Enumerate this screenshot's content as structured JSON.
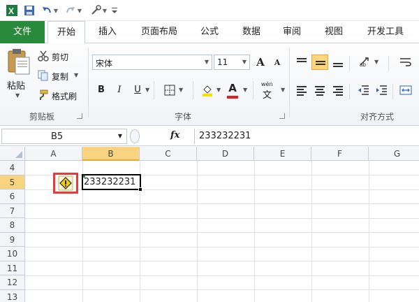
{
  "quick_access": {
    "icons": [
      "excel-icon",
      "save-icon",
      "undo-icon",
      "redo-icon",
      "customize-icon"
    ]
  },
  "tabs": [
    {
      "label": "文件",
      "active": false,
      "accent": "#2a8a3b"
    },
    {
      "label": "开始",
      "active": true
    },
    {
      "label": "插入",
      "active": false
    },
    {
      "label": "页面布局",
      "active": false
    },
    {
      "label": "公式",
      "active": false
    },
    {
      "label": "数据",
      "active": false
    },
    {
      "label": "审阅",
      "active": false
    },
    {
      "label": "视图",
      "active": false
    },
    {
      "label": "开发工具",
      "active": false
    }
  ],
  "clipboard": {
    "paste": "粘贴",
    "cut": "剪切",
    "copy": "复制",
    "format_painter": "格式刷",
    "group_label": "剪贴板"
  },
  "font": {
    "name": "宋体",
    "size": "11",
    "group_label": "字体",
    "bold": "B",
    "italic": "I",
    "underline": "U",
    "grow": "A",
    "shrink": "A",
    "font_color": "A",
    "phonetic": "wén"
  },
  "alignment": {
    "group_label": "对齐方式"
  },
  "formula_bar": {
    "name_box": "B5",
    "fx": "fx",
    "content": "233232231"
  },
  "grid": {
    "columns": [
      "A",
      "B",
      "C",
      "D",
      "E",
      "F",
      "G"
    ],
    "selected_column": "B",
    "rows": [
      "4",
      "5",
      "6",
      "7",
      "8",
      "9",
      "10",
      "11",
      "12",
      "13"
    ],
    "selected_row": "5",
    "cell_b5": "233232231",
    "error_indicator": "warning-icon"
  },
  "colors": {
    "file_tab": "#2a8a3b",
    "selection_header": "#f8d480",
    "highlight_box": "#e8393b"
  }
}
